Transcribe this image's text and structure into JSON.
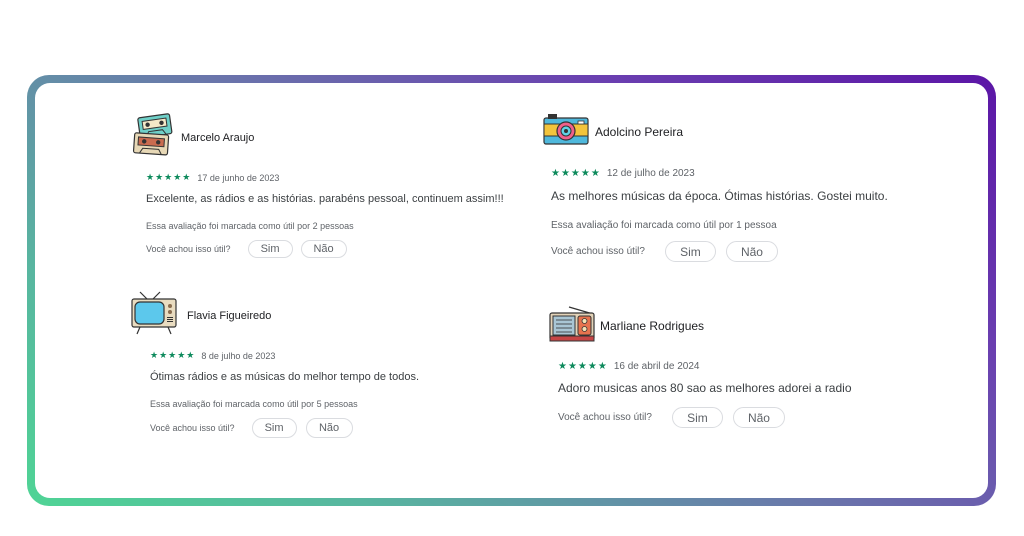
{
  "colors": {
    "star_green": "#0d8a5c",
    "gradient": [
      "#4fd495",
      "#6a76ab",
      "#5b15a6"
    ]
  },
  "reviews": [
    {
      "avatar_icon": "cassette-tapes-icon",
      "author": "Marcelo Araujo",
      "stars": "★★★★★",
      "rating": 5,
      "date": "17 de junho de 2023",
      "text": "Excelente, as rádios e as histórias. parabéns pessoal, continuem assim!!!",
      "helpful": "Essa avaliação foi marcada como útil por 2 pessoas",
      "question": "Você achou isso útil?",
      "yes": "Sim",
      "no": "Não"
    },
    {
      "avatar_icon": "camera-icon",
      "author": "Adolcino Pereira",
      "stars": "★★★★★",
      "rating": 5,
      "date": "12 de julho de 2023",
      "text": "As melhores músicas da época. Ótimas histórias. Gostei muito.",
      "helpful": "Essa avaliação foi marcada como útil por 1 pessoa",
      "question": "Você achou isso útil?",
      "yes": "Sim",
      "no": "Não"
    },
    {
      "avatar_icon": "television-icon",
      "author": "Flavia Figueiredo",
      "stars": "★★★★★",
      "rating": 5,
      "date": "8 de julho de 2023",
      "text": "Ótimas rádios e as músicas do melhor tempo de todos.",
      "helpful": "Essa avaliação foi marcada como útil por 5 pessoas",
      "question": "Você achou isso útil?",
      "yes": "Sim",
      "no": "Não"
    },
    {
      "avatar_icon": "radio-icon",
      "author": "Marliane Rodrigues",
      "stars": "★★★★★",
      "rating": 5,
      "date": "16 de abril de 2024",
      "text": "Adoro musicas anos 80 sao as melhores adorei a radio",
      "question": "Você achou isso útil?",
      "yes": "Sim",
      "no": "Não"
    }
  ]
}
